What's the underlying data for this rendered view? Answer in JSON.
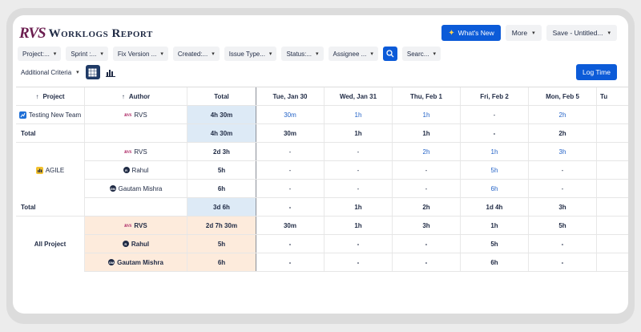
{
  "app": {
    "logo": "RVS",
    "title": "Worklogs Report"
  },
  "actions": {
    "whats_new": "What's New",
    "more": "More",
    "save": "Save - Untitled...",
    "log_time": "Log Time"
  },
  "filters": [
    "Project:...",
    "Sprint :...",
    "Fix Version ...",
    "Created:...",
    "Issue Type...",
    "Status:...",
    "Assignee ..."
  ],
  "search": {
    "placeholder": "Searc..."
  },
  "criteria": {
    "label": "Additional Criteria"
  },
  "table": {
    "headers": {
      "project": "Project",
      "author": "Author",
      "total": "Total",
      "days": [
        "Tue, Jan 30",
        "Wed, Jan 31",
        "Thu, Feb 1",
        "Fri, Feb 2",
        "Mon, Feb 5"
      ],
      "last": "Tu"
    },
    "rows": [
      {
        "project": "Testing New Team",
        "author": "RVS",
        "total": "4h 30m",
        "days": [
          "30m",
          "1h",
          "1h",
          "-",
          "2h"
        ]
      },
      {
        "project": "Total",
        "author": "",
        "total": "4h 30m",
        "days": [
          "30m",
          "1h",
          "1h",
          "-",
          "2h"
        ]
      },
      {
        "project": "AGILE",
        "author": "RVS",
        "total": "2d 3h",
        "days": [
          "-",
          "-",
          "2h",
          "1h",
          "3h"
        ]
      },
      {
        "project": "",
        "author": "Rahul",
        "total": "5h",
        "days": [
          "-",
          "-",
          "-",
          "5h",
          "-"
        ]
      },
      {
        "project": "",
        "author": "Gautam Mishra",
        "total": "6h",
        "days": [
          "-",
          "-",
          "-",
          "6h",
          "-"
        ]
      },
      {
        "project": "Total",
        "author": "",
        "total": "3d 6h",
        "days": [
          "-",
          "1h",
          "2h",
          "1d 4h",
          "3h"
        ]
      },
      {
        "project": "All Project",
        "author": "RVS",
        "total": "2d 7h 30m",
        "days": [
          "30m",
          "1h",
          "3h",
          "1h",
          "5h"
        ]
      },
      {
        "project": "",
        "author": "Rahul",
        "total": "5h",
        "days": [
          "-",
          "-",
          "-",
          "5h",
          "-"
        ]
      },
      {
        "project": "",
        "author": "Gautam Mishra",
        "total": "6h",
        "days": [
          "-",
          "-",
          "-",
          "6h",
          "-"
        ]
      }
    ]
  },
  "avatars": {
    "rahul": "R",
    "gautam": "GM"
  },
  "colors": {
    "primary": "#0c5bd8",
    "link": "#2463c7",
    "total_highlight": "#ddeaf6",
    "all_project_bg": "#fdebdc",
    "brand": "#6b1d4f"
  }
}
